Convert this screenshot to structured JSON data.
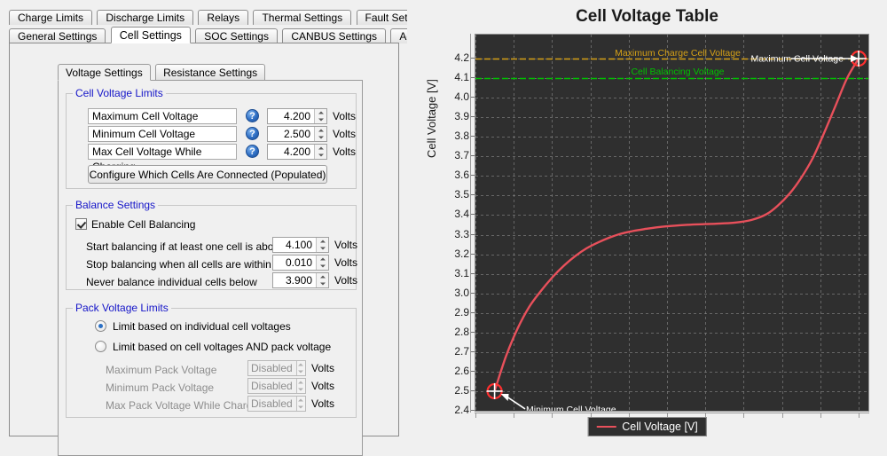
{
  "window": {
    "outer_tabs_row1": [
      {
        "label": "Charge Limits",
        "active": false
      },
      {
        "label": "Discharge Limits",
        "active": false
      },
      {
        "label": "Relays",
        "active": false
      },
      {
        "label": "Thermal Settings",
        "active": false
      },
      {
        "label": "Fault Settings",
        "active": false
      }
    ],
    "outer_tabs_row2": [
      {
        "label": "General Settings",
        "active": false
      },
      {
        "label": "Cell Settings",
        "active": true
      },
      {
        "label": "SOC Settings",
        "active": false
      },
      {
        "label": "CANBUS Settings",
        "active": false
      },
      {
        "label": "Addon Settings",
        "active": false
      }
    ],
    "inner_tabs": [
      {
        "label": "Voltage Settings",
        "active": true
      },
      {
        "label": "Resistance Settings",
        "active": false
      }
    ]
  },
  "cell_voltage_limits": {
    "legend": "Cell Voltage Limits",
    "help_icon": "question-mark-icon",
    "rows": [
      {
        "label": "Maximum Cell Voltage",
        "value": "4.200",
        "units": "Volts"
      },
      {
        "label": "Minimum Cell Voltage",
        "value": "2.500",
        "units": "Volts"
      },
      {
        "label": "Max Cell Voltage While Charging",
        "value": "4.200",
        "units": "Volts"
      }
    ],
    "configure_button": "Configure Which Cells Are Connected (Populated)"
  },
  "balance_settings": {
    "legend": "Balance Settings",
    "enable_label": "Enable Cell Balancing",
    "enable_checked": true,
    "rows": [
      {
        "label": "Start balancing if at least one cell is above",
        "value": "4.100",
        "units": "Volts"
      },
      {
        "label": "Stop balancing when all cells are within",
        "value": "0.010",
        "units": "Volts"
      },
      {
        "label": "Never balance individual cells below",
        "value": "3.900",
        "units": "Volts"
      }
    ]
  },
  "pack_voltage_limits": {
    "legend": "Pack Voltage Limits",
    "radios": [
      {
        "label": "Limit based on individual cell voltages",
        "checked": true
      },
      {
        "label": "Limit based on cell voltages AND pack voltage",
        "checked": false
      }
    ],
    "rows": [
      {
        "label": "Maximum Pack Voltage",
        "value": "Disabled",
        "units": "Volts"
      },
      {
        "label": "Minimum Pack Voltage",
        "value": "Disabled",
        "units": "Volts"
      },
      {
        "label": "Max Pack Voltage While Charging",
        "value": "Disabled",
        "units": "Volts"
      }
    ]
  },
  "chart_data": {
    "type": "line",
    "title": "Cell Voltage Table",
    "xlabel": "",
    "ylabel": "Cell Voltage [V]",
    "ylim": [
      2.4,
      4.2
    ],
    "xlim": [
      0,
      100
    ],
    "grid": true,
    "plot_background": "#2f2f2f",
    "grid_color": "#8a8a8a",
    "legend_position": "bottom-center",
    "yticks": [
      "4.2",
      "4.1",
      "4.0",
      "3.9",
      "3.8",
      "3.7",
      "3.6",
      "3.5",
      "3.4",
      "3.3",
      "3.2",
      "3.1",
      "3.0",
      "2.9",
      "2.8",
      "2.7",
      "2.6",
      "2.5",
      "2.4"
    ],
    "xticks": [
      "",
      "",
      "",
      "",
      "",
      "",
      "",
      "",
      "",
      "",
      ""
    ],
    "series": [
      {
        "name": "Cell Voltage [V]",
        "color": "#e8505b",
        "x": [
          5,
          8,
          11,
          14,
          17,
          20,
          23,
          26,
          29,
          32,
          35,
          38,
          41,
          44,
          48,
          52,
          56,
          60,
          64,
          68,
          72,
          76,
          79,
          82,
          85,
          88,
          91,
          94,
          97,
          100
        ],
        "y": [
          2.5,
          2.68,
          2.82,
          2.93,
          3.01,
          3.08,
          3.14,
          3.19,
          3.23,
          3.26,
          3.285,
          3.305,
          3.318,
          3.328,
          3.339,
          3.346,
          3.351,
          3.354,
          3.357,
          3.362,
          3.375,
          3.405,
          3.45,
          3.51,
          3.59,
          3.69,
          3.82,
          3.96,
          4.1,
          4.2
        ]
      }
    ],
    "hlines": [
      {
        "name": "Maximum Charge Cell Voltage",
        "value": 4.2,
        "color": "#d4a017",
        "label": "Maximum Charge Cell Voltage"
      },
      {
        "name": "Cell Balancing Voltage",
        "value": 4.1,
        "color": "#00c000",
        "label": "Cell Balancing Voltage"
      }
    ],
    "markers": [
      {
        "label": "Minimum Cell Voltage",
        "x": 5,
        "y": 2.5,
        "color": "#ff2f2f",
        "text_color": "#ffffff"
      },
      {
        "label": "Maximum Cell Voltage",
        "x": 100,
        "y": 4.2,
        "color": "#ff2f2f",
        "text_color": "#ffffff"
      }
    ],
    "legend_entries": [
      {
        "label": "Cell Voltage [V]",
        "color": "#e8505b"
      }
    ]
  }
}
